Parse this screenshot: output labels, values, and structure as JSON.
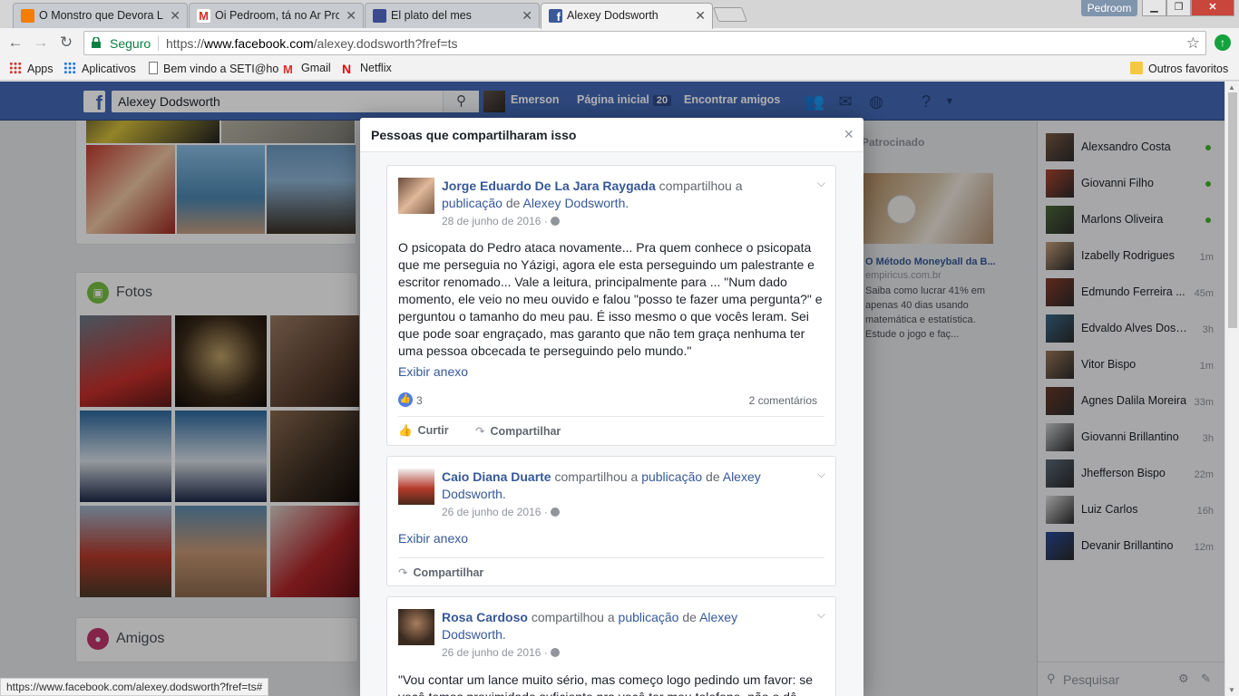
{
  "browser": {
    "tabs": [
      {
        "title": "O Monstro que Devora L",
        "color": "#f57d00"
      },
      {
        "title": "Oi Pedroom, tá no Ar Pro",
        "color": "#d93025"
      },
      {
        "title": "El plato del mes",
        "color": "#3b4a8a"
      },
      {
        "title": "Alexey Dodsworth",
        "color": "#3b5998"
      }
    ],
    "profile_name": "Pedroom",
    "secure_label": "Seguro",
    "url_prefix": "https://",
    "url_host": "www.facebook.com",
    "url_path": "/alexey.dodsworth?fref=ts",
    "bookmarks": {
      "apps": "Apps",
      "aplicativos": "Aplicativos",
      "seti": "Bem vindo a SETI@ho",
      "gmail": "Gmail",
      "netflix": "Netflix",
      "others": "Outros favoritos"
    },
    "status_url": "https://www.facebook.com/alexey.dodsworth?fref=ts#"
  },
  "facebook": {
    "search_value": "Alexey Dodsworth",
    "user_name": "Emerson",
    "home_label": "Página inicial",
    "home_count": "20",
    "find_friends": "Encontrar amigos",
    "fotos_title": "Fotos",
    "amigos_title": "Amigos",
    "sponsored": {
      "title": "Patrocinado",
      "headline": "O Método Moneyball da B...",
      "domain": "empiricus.com.br",
      "description": "Saiba como lucrar 41% em apenas 40 dias usando matemática e estatística. Estude o jogo e faç..."
    },
    "chat": {
      "contacts": [
        {
          "name": "Alexsandro Costa",
          "time": "",
          "online": true
        },
        {
          "name": "Giovanni Filho",
          "time": "",
          "online": true
        },
        {
          "name": "Marlons Oliveira",
          "time": "",
          "online": true
        },
        {
          "name": "Izabelly Rodrigues",
          "time": "1m",
          "online": false
        },
        {
          "name": "Edmundo Ferreira ...",
          "time": "45m",
          "online": false
        },
        {
          "name": "Edvaldo Alves Dos S...",
          "time": "3h",
          "online": false
        },
        {
          "name": "Vitor Bispo",
          "time": "1m",
          "online": false
        },
        {
          "name": "Agnes Dalila Moreira",
          "time": "33m",
          "online": false
        },
        {
          "name": "Giovanni Brillantino",
          "time": "3h",
          "online": false
        },
        {
          "name": "Jhefferson Bispo",
          "time": "22m",
          "online": false
        },
        {
          "name": "Luiz Carlos",
          "time": "16h",
          "online": false
        },
        {
          "name": "Devanir Brillantino",
          "time": "12m",
          "online": false
        }
      ],
      "search_placeholder": "Pesquisar"
    }
  },
  "modal": {
    "title": "Pessoas que compartilharam isso",
    "posts": [
      {
        "author": "Jorge Eduardo De La Jara Raygada",
        "shared_text": "compartilhou a",
        "publication": "publicação",
        "of": "de",
        "owner": "Alexey Dodsworth.",
        "date": "28 de junho de 2016 ·",
        "text": "O psicopata do Pedro ataca novamente... Pra quem conhece o psicopata que me perseguia no Yázigi, agora ele esta perseguindo um palestrante e escritor renomado... Vale a leitura, principalmente para ... \"Num dado momento, ele veio no meu ouvido e falou \"posso te fazer uma pergunta?\" e perguntou o tamanho do meu pau. É isso mesmo o que vocês leram. Sei que pode soar engraçado, mas garanto que não tem graça nenhuma ter uma pessoa obcecada te perseguindo pelo mundo.\"",
        "attachment": "Exibir anexo",
        "likes": "3",
        "comments": "2 comentários",
        "like_action": "Curtir",
        "share_action": "Compartilhar"
      },
      {
        "author": "Caio Diana Duarte",
        "shared_text": "compartilhou a",
        "publication": "publicação",
        "of": "de",
        "owner": "Alexey Dodsworth.",
        "date": "26 de junho de 2016 ·",
        "attachment": "Exibir anexo",
        "share_action": "Compartilhar"
      },
      {
        "author": "Rosa Cardoso",
        "shared_text": "compartilhou a",
        "publication": "publicação",
        "of": "de",
        "owner": "Alexey Dodsworth.",
        "date": "26 de junho de 2016 ·",
        "text": "\"Vou contar um lance muito sério, mas começo logo pedindo um favor: se você temos proximidade suficiente pra você ter meu telefone, não o dê"
      }
    ]
  }
}
